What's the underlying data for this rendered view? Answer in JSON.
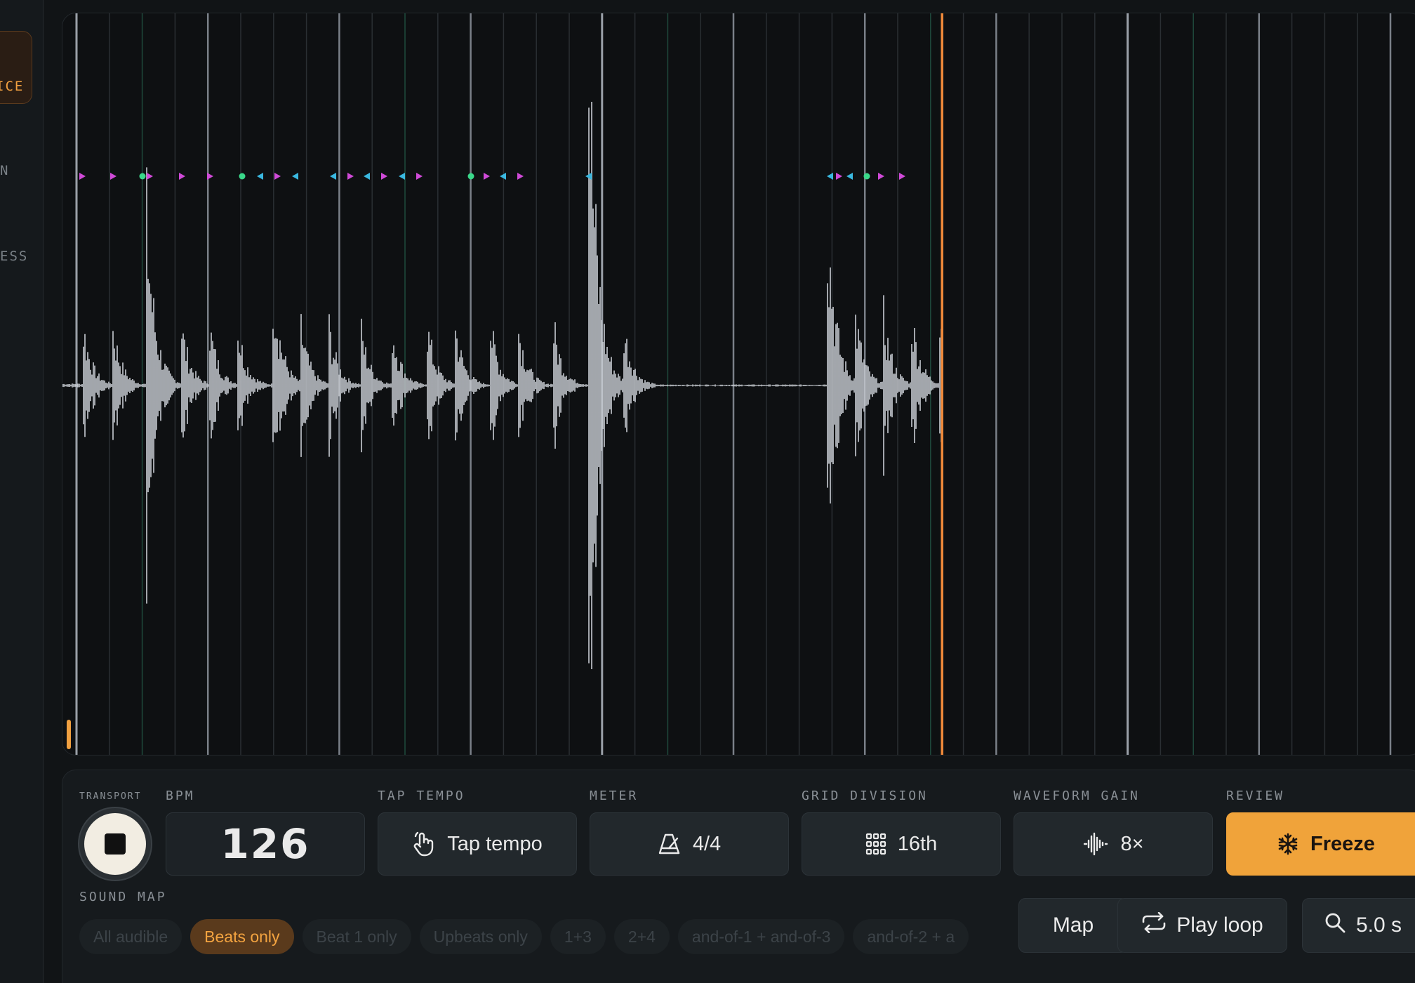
{
  "sidebar": {
    "items": [
      {
        "label": "ICE",
        "active": true,
        "icon": "none"
      },
      {
        "label": "N",
        "active": false,
        "icon": "none"
      },
      {
        "label": "ESS",
        "active": false,
        "icon": "none"
      }
    ]
  },
  "colors": {
    "accent": "#f0a33a",
    "playhead": "#f08a3a",
    "waveform": "#c8ccd2",
    "marker_magenta": "#d04ad8",
    "marker_green": "#3ad88a",
    "marker_cyan": "#3ab8e0"
  },
  "transport": {
    "label": "TRANSPORT",
    "state": "playing",
    "button_icon": "stop-icon"
  },
  "bpm": {
    "label": "BPM",
    "value": "126"
  },
  "tap_tempo": {
    "label": "TAP TEMPO",
    "button_label": "Tap tempo",
    "icon": "hand-pointer-icon"
  },
  "meter": {
    "label": "METER",
    "value": "4/4",
    "icon": "metronome-icon"
  },
  "grid_division": {
    "label": "GRID DIVISION",
    "value": "16th",
    "icon": "grid-icon"
  },
  "waveform_gain": {
    "label": "WAVEFORM GAIN",
    "value": "8×",
    "icon": "waveform-icon"
  },
  "review": {
    "label": "REVIEW",
    "button_label": "Freeze",
    "icon": "snowflake-icon"
  },
  "sound_map": {
    "label": "SOUND MAP",
    "selected": "Beats only",
    "options": [
      "All audible",
      "Beats only",
      "Beat 1 only",
      "Upbeats only",
      "1+3",
      "2+4",
      "and-of-1 + and-of-3",
      "and-of-2 + a"
    ]
  },
  "bottom_buttons": {
    "map": "Map",
    "play_loop": "Play loop",
    "zoom": "5.0 s"
  },
  "timeline": {
    "playhead_fraction": 0.646,
    "loop_start_fraction": 0.004
  }
}
